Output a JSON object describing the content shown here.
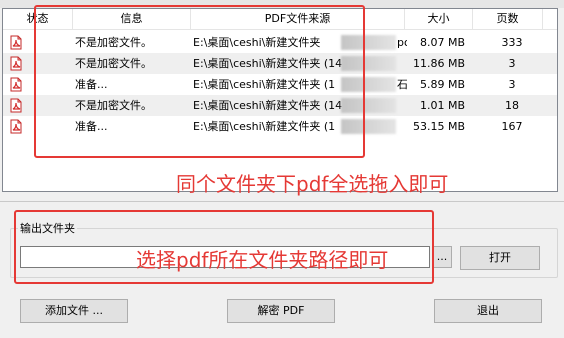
{
  "table": {
    "columns": [
      "状态",
      "信息",
      "PDF文件来源",
      "大小",
      "页数"
    ],
    "rows": [
      {
        "info": "不是加密文件。",
        "source": "E:\\桌面\\ceshi\\新建文件夹",
        "source_tail": "po",
        "size": "8.07 MB",
        "pages": "333"
      },
      {
        "info": "不是加密文件。",
        "source": "E:\\桌面\\ceshi\\新建文件夹 (14)",
        "source_tail": "",
        "size": "11.86 MB",
        "pages": "3"
      },
      {
        "info": "准备...",
        "source": "E:\\桌面\\ceshi\\新建文件夹 (1",
        "source_tail": "石",
        "size": "5.89 MB",
        "pages": "3"
      },
      {
        "info": "不是加密文件。",
        "source": "E:\\桌面\\ceshi\\新建文件夹 (14",
        "source_tail": "",
        "size": "1.01 MB",
        "pages": "18"
      },
      {
        "info": "准备...",
        "source": "E:\\桌面\\ceshi\\新建文件夹 (1",
        "source_tail": "",
        "size": "53.15 MB",
        "pages": "167"
      }
    ]
  },
  "annotations": {
    "list_hint": "同个文件夹下pdf全选拖入即可",
    "path_hint": "选择pdf所在文件夹路径即可",
    "color": "#e53935"
  },
  "output": {
    "group_label": "输出文件夹",
    "path_value": "",
    "browse_label": "...",
    "open_label": "打开"
  },
  "buttons": {
    "add": "添加文件 ...",
    "decrypt": "解密 PDF",
    "exit": "退出"
  },
  "icons": {
    "row_icon": "pdf-file-icon"
  }
}
